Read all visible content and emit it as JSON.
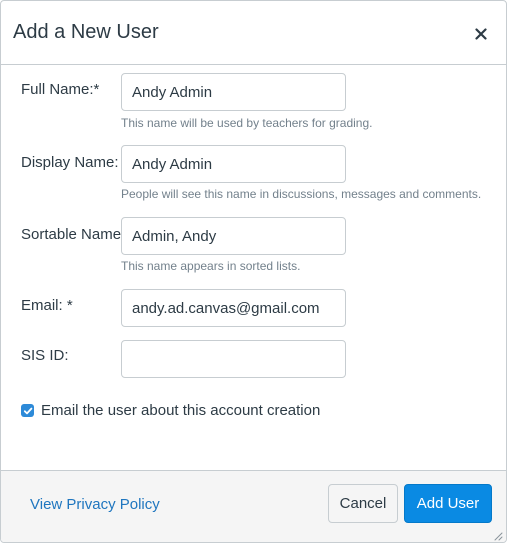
{
  "dialog": {
    "title": "Add a New User",
    "close_icon": "close-icon"
  },
  "form": {
    "full_name": {
      "label": "Full Name:*",
      "value": "Andy Admin",
      "hint": "This name will be used by teachers for grading."
    },
    "display_name": {
      "label": "Display Name:",
      "value": "Andy Admin",
      "hint": "People will see this name in discussions, messages and comments."
    },
    "sortable_name": {
      "label": "Sortable Name:",
      "value": "Admin, Andy",
      "hint": "This name appears in sorted lists."
    },
    "email": {
      "label": "Email: *",
      "value": "andy.ad.canvas@gmail.com"
    },
    "sis_id": {
      "label": "SIS ID:",
      "value": ""
    },
    "notify": {
      "label": "Email the user about this account creation",
      "checked": true
    }
  },
  "footer": {
    "privacy_link": "View Privacy Policy",
    "cancel_label": "Cancel",
    "submit_label": "Add User"
  },
  "colors": {
    "accent": "#0a8ae3",
    "link": "#1f76bf",
    "hint_text": "#73818c",
    "border": "#c7cdd1",
    "footer_bg": "#f5f5f5"
  }
}
